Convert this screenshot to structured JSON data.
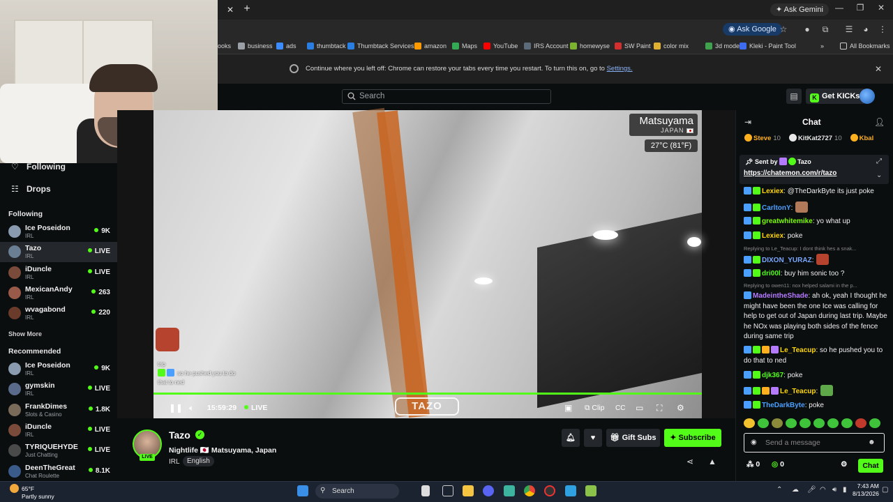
{
  "browser": {
    "ask_gemini": "Ask Gemini",
    "ask_google": "Ask Google",
    "bookmarks": [
      {
        "label": "ooks",
        "color": "#555555"
      },
      {
        "label": "business",
        "color": "#9aa0a6"
      },
      {
        "label": "ads",
        "color": "#3c8cff"
      },
      {
        "label": "thumbtack",
        "color": "#2a7de1"
      },
      {
        "label": "Thumbtack Services",
        "color": "#2a7de1"
      },
      {
        "label": "amazon",
        "color": "#ff9900"
      },
      {
        "label": "Maps",
        "color": "#34a853"
      },
      {
        "label": "YouTube",
        "color": "#ff0000"
      },
      {
        "label": "IRS Account",
        "color": "#5b6b7a"
      },
      {
        "label": "homewyse",
        "color": "#7bb32e"
      },
      {
        "label": "SW Paint",
        "color": "#d32f2f"
      },
      {
        "label": "color mix",
        "color": "#e0b030"
      },
      {
        "label": "3d models",
        "color": "#3fa34d"
      },
      {
        "label": "Kleki - Paint Tool",
        "color": "#3d6cf0"
      }
    ],
    "all_bookmarks": "All Bookmarks",
    "restore_text": "Continue where you left off: Chrome can restore your tabs every time you restart. To turn this on, go to",
    "restore_link": "Settings."
  },
  "header": {
    "search_placeholder": "Search",
    "get_kicks": "Get KICKs"
  },
  "sidebar": {
    "top_items": [
      {
        "label": "Following"
      },
      {
        "label": "Drops"
      }
    ],
    "following_title": "Following",
    "following": [
      {
        "name": "Ice Poseidon",
        "category": "IRL",
        "stat": "9K",
        "color": "#8a9bb0"
      },
      {
        "name": "Tazo",
        "category": "IRL",
        "stat": "LIVE",
        "color": "#6b7f94"
      },
      {
        "name": "iDuncle",
        "category": "IRL",
        "stat": "LIVE",
        "color": "#7a4a3a"
      },
      {
        "name": "MexicanAndy",
        "category": "IRL",
        "stat": "263",
        "color": "#9a5a4a"
      },
      {
        "name": "wvagabond",
        "category": "IRL",
        "stat": "220",
        "color": "#6a3a2a"
      }
    ],
    "show_more": "Show More",
    "recommended_title": "Recommended",
    "recommended": [
      {
        "name": "Ice Poseidon",
        "category": "IRL",
        "stat": "9K",
        "color": "#8a9bb0"
      },
      {
        "name": "gymskin",
        "category": "IRL",
        "stat": "LIVE",
        "color": "#5a6a8a"
      },
      {
        "name": "FrankDimes",
        "category": "Slots & Casino",
        "stat": "1.8K",
        "color": "#7a6a5a"
      },
      {
        "name": "iDuncle",
        "category": "IRL",
        "stat": "LIVE",
        "color": "#7a4a3a"
      },
      {
        "name": "TYRIQUEHYDE",
        "category": "Just Chatting",
        "stat": "LIVE",
        "color": "#4a4a4a"
      },
      {
        "name": "DeenTheGreat",
        "category": "Chat Roulette",
        "stat": "8.1K",
        "color": "#3a5a8a"
      }
    ]
  },
  "video": {
    "city": "Matsuyama",
    "country": "JAPAN",
    "temp": "27°C (81°F)",
    "overlay_chat": [
      "trip",
      "so he pushed you to do",
      "that to ned"
    ],
    "time": "15:59:29",
    "live": "LIVE",
    "clip": "Clip",
    "watermark": "TAZO"
  },
  "stream": {
    "name": "Tazo",
    "title": "Nightlife 🇯🇵 Matsuyama, Japan",
    "live_badge": "LIVE",
    "tag_category": "IRL",
    "tag_lang": "English",
    "gift_subs": "Gift Subs",
    "subscribe": "Subscribe"
  },
  "chat": {
    "title": "Chat",
    "leaderboard": [
      {
        "name": "Steve",
        "count": "10",
        "color": "#ffb01f"
      },
      {
        "name": "KitKat2727",
        "count": "10",
        "color": "#e8e8e8"
      },
      {
        "name": "Kbal",
        "count": "",
        "color": "#ffb01f"
      }
    ],
    "pinned_from": "Sent by",
    "pinned_user": "Tazo",
    "pinned_link": "https://chatemon.com/r/tazo",
    "messages": [
      {
        "type": "msg",
        "user": "Lexiex",
        "color": "#ffd700",
        "text": ": @TheDarkByte its just poke"
      },
      {
        "type": "msg",
        "user": "CarltonY",
        "color": "#4a9fff",
        "text": ":"
      },
      {
        "type": "msg",
        "user": "greatwhitemike",
        "color": "#7cfc00",
        "text": ": yo what up"
      },
      {
        "type": "msg",
        "user": "Lexiex",
        "color": "#ffd700",
        "text": ": poke"
      },
      {
        "type": "reply",
        "text": "Replying to Le_Teacup: I dont think hes a snak..."
      },
      {
        "type": "msg",
        "user": "DIXON_YURAZ",
        "color": "#7aa7ff",
        "text": ":"
      },
      {
        "type": "msg",
        "user": "dri00l",
        "color": "#53fc18",
        "text": ": buy him sonic too ?"
      },
      {
        "type": "reply",
        "text": "Replying to owen11: nox helped salami in the p..."
      },
      {
        "type": "msg",
        "user": "MadeintheShade",
        "color": "#b57bff",
        "text": ": ah ok, yeah I thought he might have been the one Ice was calling for help to get out of Japan during last trip. Maybe he NOx was playing both sides of the fence during same trip"
      },
      {
        "type": "msg",
        "user": "Le_Teacup",
        "color": "#ffd700",
        "text": ": so he pushed you to do that to ned"
      },
      {
        "type": "msg",
        "user": "djk367",
        "color": "#53fc18",
        "text": ": poke"
      },
      {
        "type": "msg",
        "user": "Le_Teacup",
        "color": "#ffd700",
        "text": ":"
      },
      {
        "type": "msg",
        "user": "TheDarkByte",
        "color": "#4a9fff",
        "text": ": poke"
      }
    ],
    "input_placeholder": "Send a message",
    "count_a": "0",
    "count_b": "0",
    "send": "Chat"
  },
  "taskbar": {
    "temp": "65°F",
    "weather": "Partly sunny",
    "search": "Search",
    "time": "7:43 AM",
    "date": "8/13/2026"
  }
}
